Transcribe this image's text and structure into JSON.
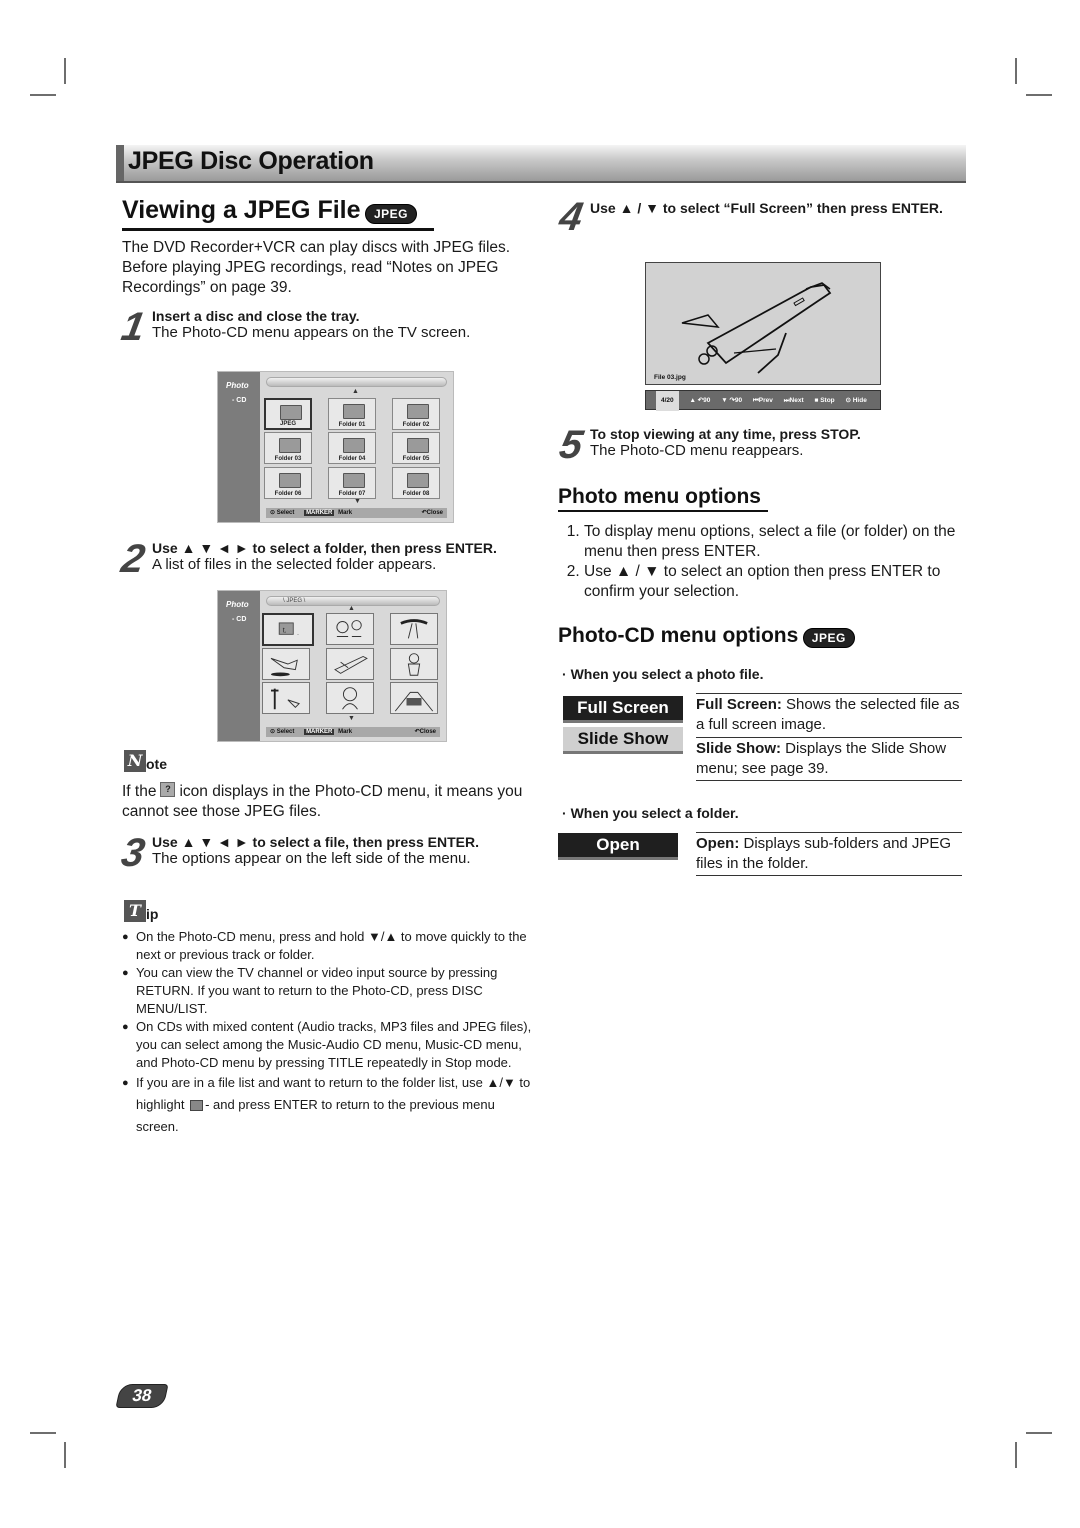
{
  "header": {
    "title": "JPEG Disc Operation"
  },
  "left": {
    "title": "Viewing a JPEG File",
    "badge": "JPEG",
    "intro": "The DVD Recorder+VCR can play discs with JPEG files. Before playing JPEG recordings, read “Notes on JPEG Recordings” on page 39.",
    "steps": [
      {
        "num": "1",
        "title": "Insert a disc and close the tray.",
        "text": "The Photo-CD menu appears on the TV screen."
      },
      {
        "num": "2",
        "title": "Use ▲ ▼ ◄ ►  to select a folder, then press ENTER.",
        "text": "A list of files in the selected folder appears."
      },
      {
        "num": "3",
        "title": "Use ▲ ▼ ◄ ►  to select a file, then press ENTER.",
        "text": "The options appear on the left side of the menu."
      }
    ],
    "menu1": {
      "side_title": "Photo",
      "side_sub": "- CD",
      "path": "",
      "folders": [
        "JPEG",
        "Folder 01",
        "Folder 02",
        "Folder 03",
        "Folder 04",
        "Folder 05",
        "Folder 06",
        "Folder 07",
        "Folder 08"
      ],
      "footer": {
        "select": "Select",
        "marker": "MARKER",
        "mark": "Mark",
        "close": "Close"
      }
    },
    "menu2": {
      "side_title": "Photo",
      "side_sub": "- CD",
      "path": "\\ JPEG \\",
      "footer": {
        "select": "Select",
        "marker": "MARKER",
        "mark": "Mark",
        "close": "Close"
      }
    },
    "note": {
      "icon_letter": "N",
      "label": "ote",
      "text_before": "If the",
      "icon_glyph": "?",
      "text_after": "icon displays in the Photo-CD menu, it means you cannot see those JPEG files."
    },
    "tip": {
      "icon_letter": "T",
      "label": "ip",
      "items": [
        "On the Photo-CD menu, press and hold ▼/▲ to move quickly to the next or previous track or folder.",
        "You can view the TV channel or video input source by pressing RETURN. If you want to return to the Photo-CD, press DISC MENU/LIST.",
        "On CDs with mixed content (Audio tracks, MP3 files and JPEG files), you can select among the Music-Audio CD menu, Music-CD menu, and Photo-CD menu by pressing TITLE repeatedly in Stop mode."
      ],
      "last_item_before": "If you are in a file list and want to return to the folder list, use ▲/▼ to highlight",
      "last_item_after": "- and press ENTER to return to the previous menu screen."
    }
  },
  "right": {
    "step4": {
      "num": "4",
      "title": "Use ▲ / ▼  to select “Full Screen” then press ENTER."
    },
    "fullscreen": {
      "filename": "File 03.jpg",
      "counter": "4/20",
      "controls": [
        "▲ ↶90",
        "▼ ↷90",
        "⏮Prev",
        "⏭Next",
        "■ Stop",
        "⊙ Hide"
      ]
    },
    "step5": {
      "num": "5",
      "title": "To stop viewing at any time, press STOP.",
      "text": "The Photo-CD menu reappears."
    },
    "photo_menu_options": {
      "title": "Photo menu options",
      "items": [
        "To display menu options, select a file (or folder) on the menu then press ENTER.",
        "Use ▲ / ▼ to select an option then press ENTER to confirm your selection."
      ]
    },
    "photocd_menu_options": {
      "title": "Photo-CD menu options",
      "badge": "JPEG",
      "photo_file_heading": "When you select a photo file.",
      "photo_buttons": [
        "Full Screen",
        "Slide Show"
      ],
      "photo_desc": [
        {
          "term": "Full Screen:",
          "text": " Shows the selected file as a full screen image."
        },
        {
          "term": "Slide Show:",
          "text": " Displays the Slide Show menu; see page 39."
        }
      ],
      "folder_heading": "When you select a folder.",
      "folder_button": "Open",
      "folder_desc": {
        "term": "Open:",
        "text": " Displays sub-folders and JPEG files in the folder."
      }
    }
  },
  "footer": {
    "page_number": "38"
  }
}
